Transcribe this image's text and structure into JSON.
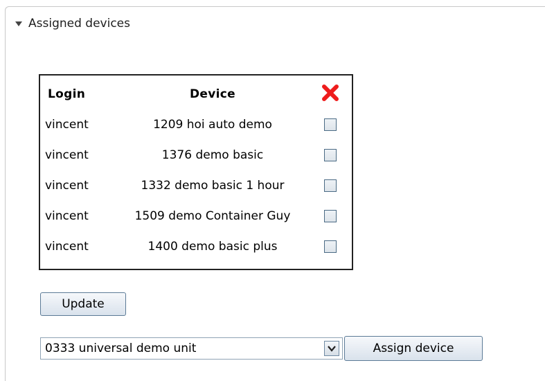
{
  "section": {
    "title": "Assigned devices",
    "expanded": true
  },
  "table": {
    "headers": {
      "login": "Login",
      "device": "Device",
      "delete_icon": "red-x-delete-icon"
    },
    "rows": [
      {
        "login": "vincent",
        "device": "1209 hoi auto demo",
        "checked": false
      },
      {
        "login": "vincent",
        "device": "1376 demo basic",
        "checked": false
      },
      {
        "login": "vincent",
        "device": "1332 demo basic 1 hour",
        "checked": false
      },
      {
        "login": "vincent",
        "device": "1509 demo Container Guy",
        "checked": false
      },
      {
        "login": "vincent",
        "device": "1400 demo basic plus",
        "checked": false
      }
    ]
  },
  "update_button": {
    "label": "Update"
  },
  "device_select": {
    "selected": "0333 universal demo unit"
  },
  "assign_button": {
    "label": "Assign device"
  },
  "colors": {
    "delete_red": "#ee1c1c",
    "button_border": "#5b7a96",
    "table_border": "#222222"
  }
}
